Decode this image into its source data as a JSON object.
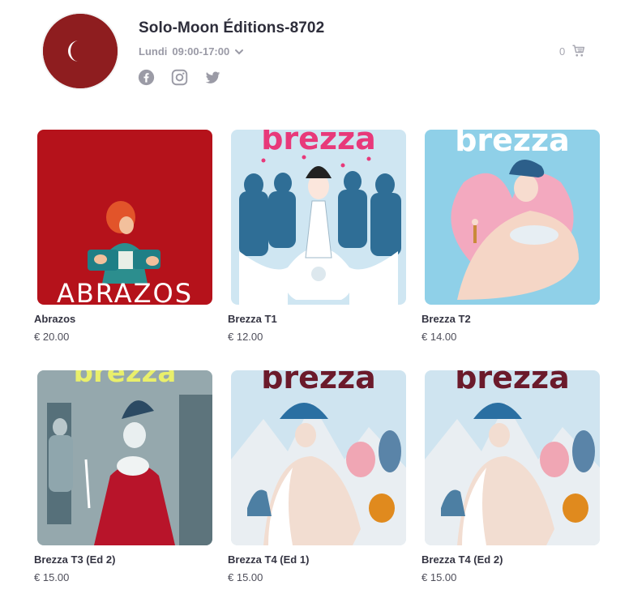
{
  "shop": {
    "name": "Solo-Moon Éditions-8702",
    "day": "Lundi",
    "hours": "09:00-17:00",
    "cart_count": "0",
    "brand_color": "#8e1d1f"
  },
  "icons": {
    "logo": "crescent-moon-icon",
    "hours_toggle": "chevron-down-icon",
    "social": [
      "facebook-icon",
      "instagram-icon",
      "twitter-icon"
    ],
    "cart": "shopping-cart-icon"
  },
  "products": [
    {
      "title": "Abrazos",
      "price": "€ 20.00",
      "cover_text": "ABRAZOS",
      "cover_bg": "#b5121b"
    },
    {
      "title": "Brezza T1",
      "price": "€ 12.00",
      "cover_text": "brezza",
      "cover_bg": "#cfe6f2"
    },
    {
      "title": "Brezza T2",
      "price": "€ 14.00",
      "cover_text": "brezza",
      "cover_bg": "#8fd0e8"
    },
    {
      "title": "Brezza T3 (Ed 2)",
      "price": "€ 15.00",
      "cover_text": "brezza",
      "cover_bg": "#aab9bd"
    },
    {
      "title": "Brezza T4 (Ed 1)",
      "price": "€ 15.00",
      "cover_text": "brezza",
      "cover_bg": "#cfe4f0"
    },
    {
      "title": "Brezza T4 (Ed 2)",
      "price": "€ 15.00",
      "cover_text": "brezza",
      "cover_bg": "#cfe4f0"
    }
  ]
}
